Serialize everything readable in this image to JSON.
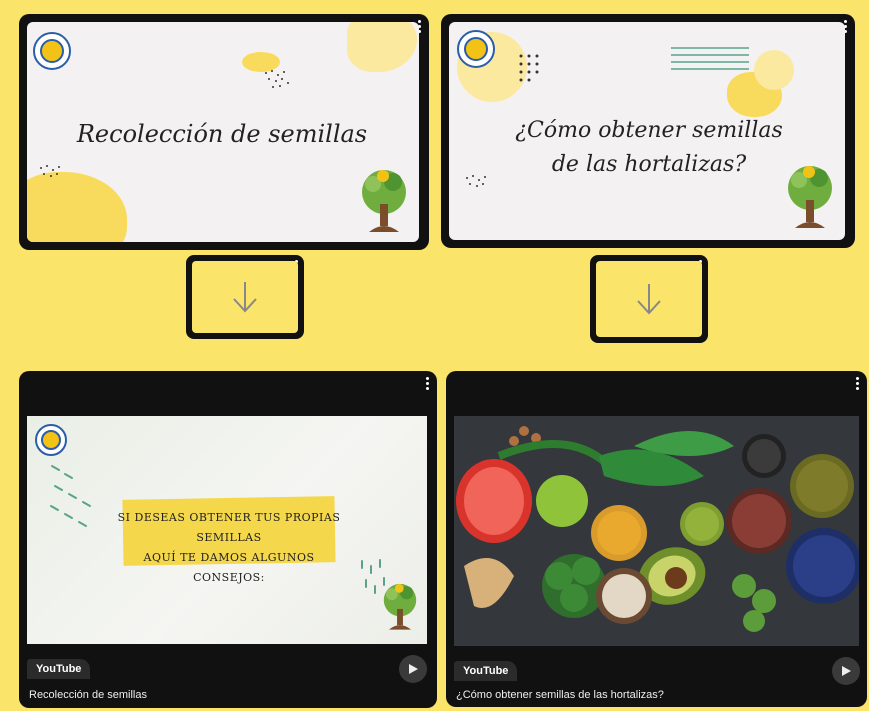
{
  "cards": {
    "slide1": {
      "title": "Recolección de semillas"
    },
    "slide2": {
      "title_line1": "¿Cómo obtener semillas",
      "title_line2": "de las hortalizas?"
    },
    "video1": {
      "banner_line1": "SI DESEAS OBTENER TUS PROPIAS SEMILLAS",
      "banner_line2": "AQUÍ TE DAMOS ALGUNOS CONSEJOS:",
      "platform": "YouTube",
      "caption": "Recolección de semillas"
    },
    "video2": {
      "platform": "YouTube",
      "caption": "¿Cómo obtener semillas de las hortalizas?"
    }
  },
  "icons": {
    "arrow": "arrow-down-icon",
    "menu": "more-vertical-icon",
    "play": "play-icon"
  },
  "colors": {
    "background": "#fbe46a",
    "accent_yellow": "#f8db5c",
    "frame": "#111111"
  }
}
